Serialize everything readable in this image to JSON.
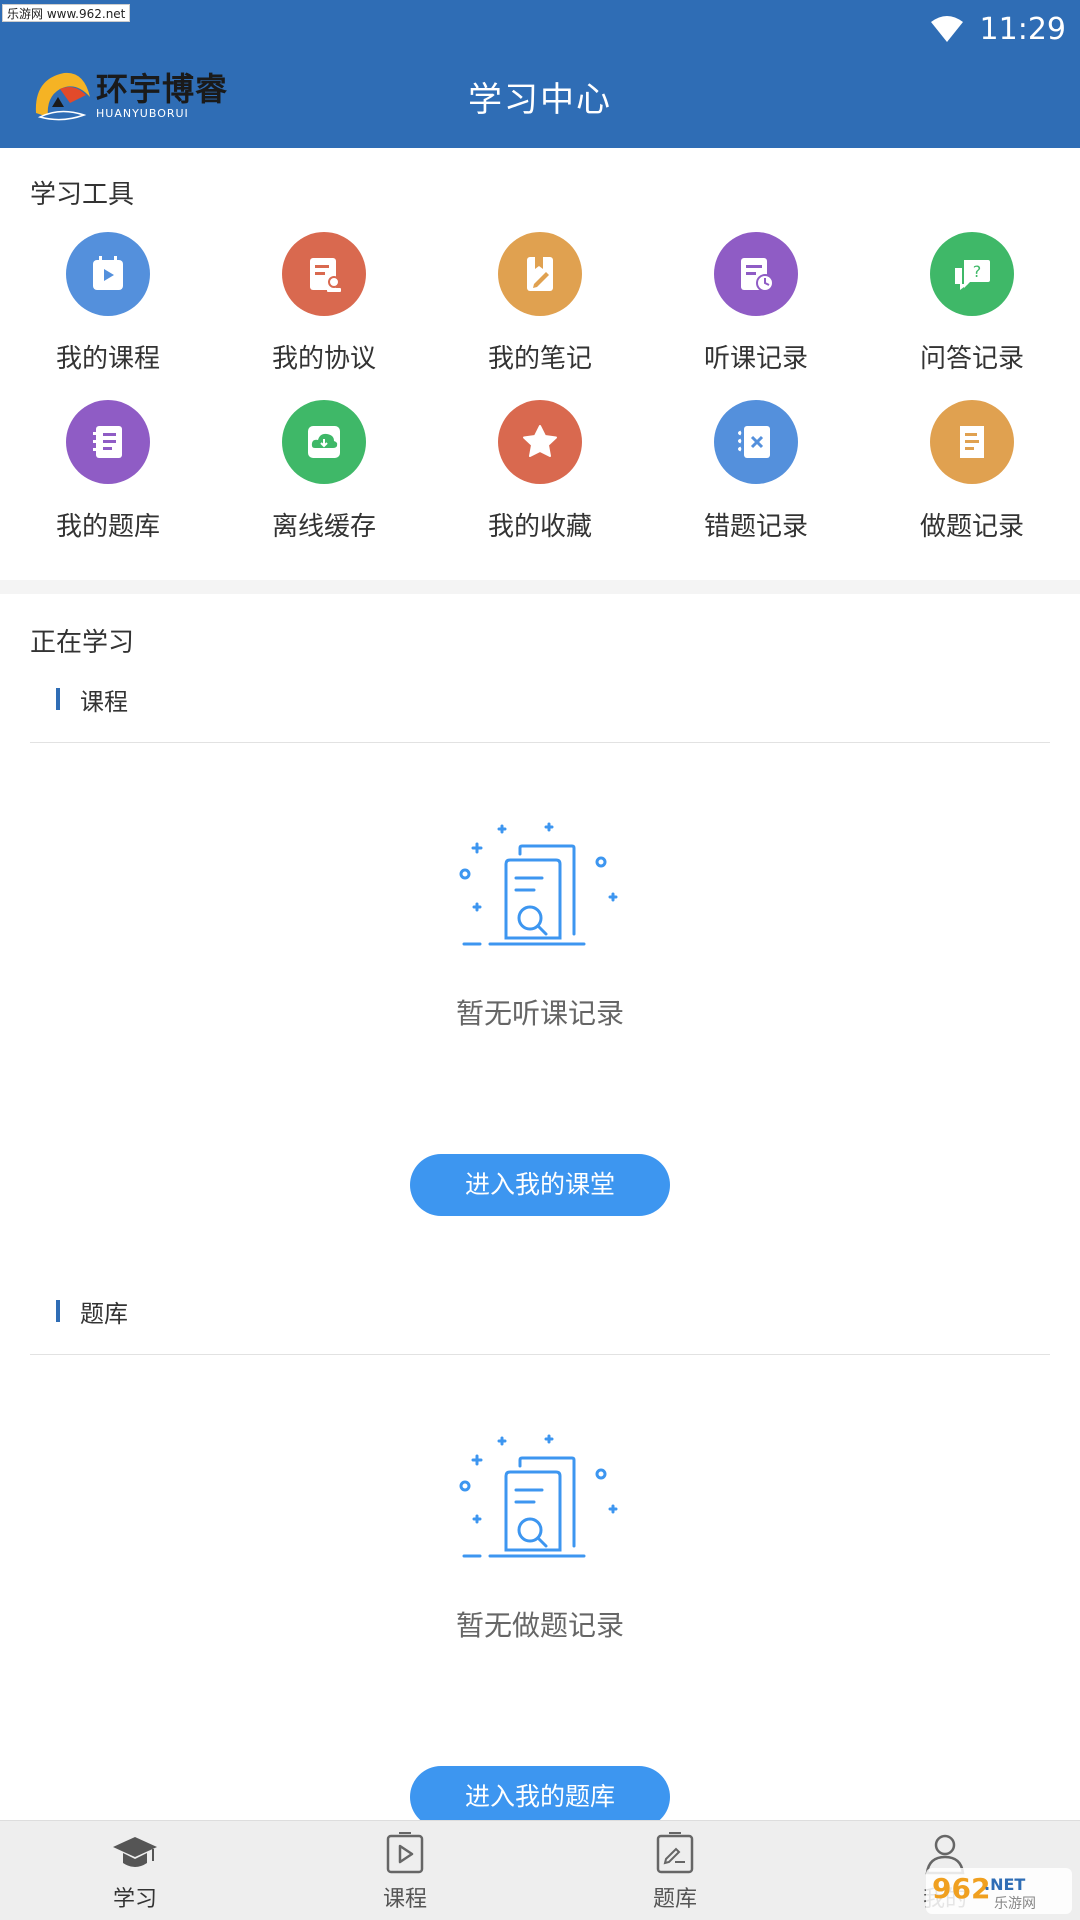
{
  "watermark_top": "乐游网 www.962.net",
  "status": {
    "time": "11:29"
  },
  "header": {
    "logo_cn": "环宇博睿",
    "logo_en": "HUANYUBORUI",
    "title": "学习中心"
  },
  "tools": {
    "title": "学习工具",
    "items": [
      {
        "label": "我的课程",
        "color": "#5490dc",
        "icon": "course-icon"
      },
      {
        "label": "我的协议",
        "color": "#d9694f",
        "icon": "agreement-icon"
      },
      {
        "label": "我的笔记",
        "color": "#e0a150",
        "icon": "note-icon"
      },
      {
        "label": "听课记录",
        "color": "#8f5cc5",
        "icon": "listen-record-icon"
      },
      {
        "label": "问答记录",
        "color": "#3fb868",
        "icon": "qa-record-icon"
      },
      {
        "label": "我的题库",
        "color": "#8f5cc5",
        "icon": "question-bank-icon"
      },
      {
        "label": "离线缓存",
        "color": "#3fb868",
        "icon": "offline-cache-icon"
      },
      {
        "label": "我的收藏",
        "color": "#d9694f",
        "icon": "favorite-icon"
      },
      {
        "label": "错题记录",
        "color": "#5490dc",
        "icon": "wrong-question-icon"
      },
      {
        "label": "做题记录",
        "color": "#e0a150",
        "icon": "practice-record-icon"
      }
    ]
  },
  "learning": {
    "title": "正在学习",
    "course": {
      "label": "课程",
      "empty_text": "暂无听课记录",
      "button": "进入我的课堂"
    },
    "bank": {
      "label": "题库",
      "empty_text": "暂无做题记录",
      "button": "进入我的题库"
    }
  },
  "nav": {
    "items": [
      {
        "label": "学习",
        "icon": "graduation-cap-icon",
        "active": true
      },
      {
        "label": "课程",
        "icon": "video-play-icon",
        "active": false
      },
      {
        "label": "题库",
        "icon": "edit-sheet-icon",
        "active": false
      },
      {
        "label": "我的",
        "icon": "user-icon",
        "active": false
      }
    ]
  },
  "watermark_brand": {
    "main": "962",
    "net": ".NET",
    "cn": "乐游网"
  },
  "colors": {
    "primary": "#2f6db5",
    "button": "#3d96f0",
    "illustration": "#3d96f0"
  }
}
